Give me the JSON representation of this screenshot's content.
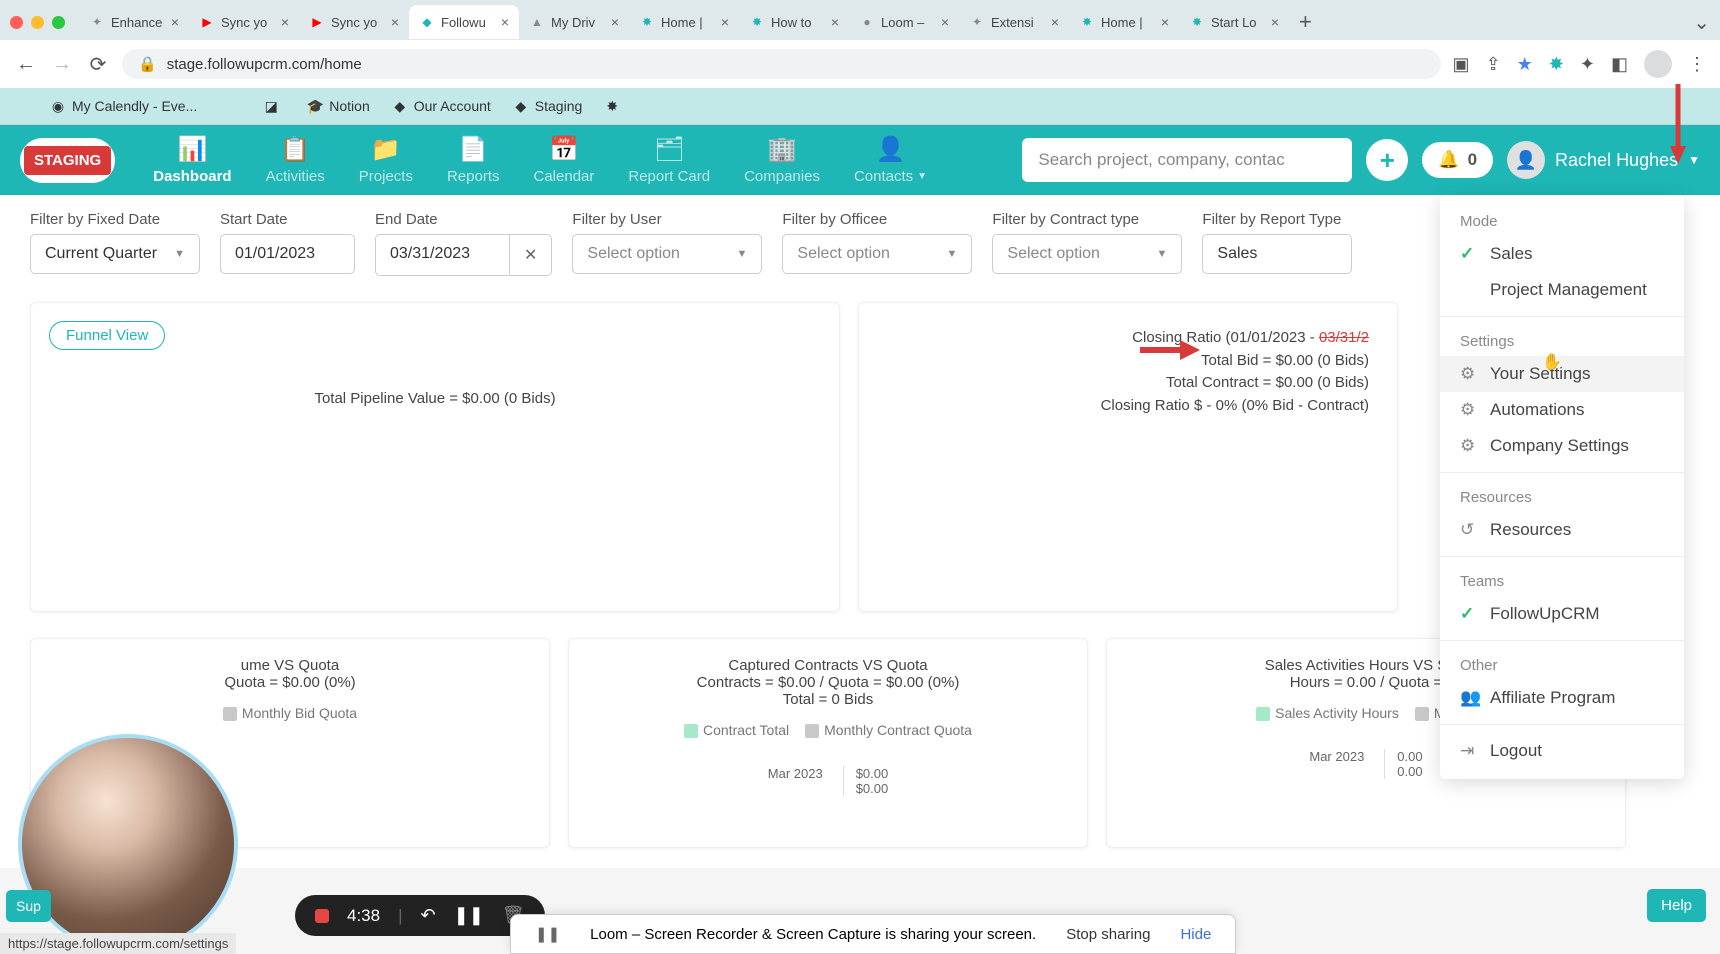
{
  "browser": {
    "tabs": [
      {
        "favicon": "✦",
        "title": "Enhance"
      },
      {
        "favicon": "▶",
        "title": "Sync yo",
        "fav_color": "#ff0000"
      },
      {
        "favicon": "▶",
        "title": "Sync yo",
        "fav_color": "#ff0000"
      },
      {
        "favicon": "◆",
        "title": "Followu",
        "active": true,
        "fav_color": "#1fb6b6"
      },
      {
        "favicon": "▲",
        "title": "My Driv"
      },
      {
        "favicon": "✸",
        "title": "Home |",
        "fav_color": "#1fb6b6"
      },
      {
        "favicon": "✸",
        "title": "How to",
        "fav_color": "#1fb6b6"
      },
      {
        "favicon": "●",
        "title": "Loom –"
      },
      {
        "favicon": "✦",
        "title": "Extensi"
      },
      {
        "favicon": "✸",
        "title": "Home |",
        "fav_color": "#1fb6b6"
      },
      {
        "favicon": "✸",
        "title": "Start Lo",
        "fav_color": "#1fb6b6"
      }
    ],
    "url": "stage.followupcrm.com/home",
    "bookmarks": [
      {
        "icon": "◉",
        "label": "My Calendly - Eve..."
      },
      {
        "icon": "",
        "label": ""
      },
      {
        "icon": "◪",
        "label": ""
      },
      {
        "icon": "🎓",
        "label": "Notion"
      },
      {
        "icon": "◆",
        "label": "Our Account"
      },
      {
        "icon": "◆",
        "label": "Staging"
      },
      {
        "icon": "✸",
        "label": ""
      }
    ]
  },
  "header": {
    "staging_label": "STAGING",
    "nav": [
      {
        "icon": "📊",
        "label": "Dashboard",
        "active": true
      },
      {
        "icon": "📋",
        "label": "Activities"
      },
      {
        "icon": "📁",
        "label": "Projects"
      },
      {
        "icon": "📄",
        "label": "Reports"
      },
      {
        "icon": "📅",
        "label": "Calendar"
      },
      {
        "icon": "🗂",
        "label": "Report Card"
      },
      {
        "icon": "🏢",
        "label": "Companies"
      },
      {
        "icon": "👤",
        "label": "Contacts",
        "caret": true
      }
    ],
    "search_placeholder": "Search project, company, contac",
    "notification_count": "0",
    "user_name": "Rachel Hughes"
  },
  "filters": {
    "fixed_date": {
      "label": "Filter by Fixed Date",
      "value": "Current Quarter"
    },
    "start_date": {
      "label": "Start Date",
      "value": "01/01/2023"
    },
    "end_date": {
      "label": "End Date",
      "value": "03/31/2023"
    },
    "by_user": {
      "label": "Filter by User",
      "value": "Select option"
    },
    "by_office": {
      "label": "Filter by Officee",
      "value": "Select option"
    },
    "by_contract": {
      "label": "Filter by Contract type",
      "value": "Select option"
    },
    "by_report": {
      "label": "Filter by Report Type",
      "value": "Sales"
    }
  },
  "pipeline": {
    "funnel_label": "Funnel View",
    "text": "Total Pipeline Value = $0.00 (0 Bids)"
  },
  "closing": {
    "line1": "Closing Ratio (01/01/2023 - ",
    "line2": "Total Bid = $0.00 (0 Bids)",
    "line3": "Total Contract = $0.00 (0 Bids)",
    "line4": "Closing Ratio $ - 0% (0% Bid - Contract)"
  },
  "chart1": {
    "title": "ume VS Quota",
    "sub": "Quota = $0.00 (0%)",
    "legend": "Monthly Bid Quota"
  },
  "chart2": {
    "title": "Captured Contracts VS Quota",
    "sub": "Contracts = $0.00 / Quota = $0.00 (0%)",
    "sub2": "Total = 0 Bids",
    "legend1": "Contract Total",
    "legend2": "Monthly Contract Quota",
    "x": "Mar 2023",
    "v1": "$0.00",
    "v2": "$0.00"
  },
  "chart3": {
    "title": "Sales Activities Hours VS Sale",
    "sub": "Hours = 0.00 / Quota = ",
    "legend1": "Sales Activity Hours",
    "legend2": "Monthl",
    "x": "Mar 2023",
    "v1": "0.00",
    "v2": "0.00"
  },
  "dropdown": {
    "mode_label": "Mode",
    "mode_items": [
      "Sales",
      "Project Management"
    ],
    "settings_label": "Settings",
    "settings_items": [
      "Your Settings",
      "Automations",
      "Company Settings"
    ],
    "resources_label": "Resources",
    "resources_item": "Resources",
    "teams_label": "Teams",
    "teams_item": "FollowUpCRM",
    "other_label": "Other",
    "affiliate": "Affiliate Program",
    "logout": "Logout"
  },
  "loom": {
    "time": "4:38",
    "banner": "Loom – Screen Recorder & Screen Capture is sharing your screen.",
    "stop": "Stop sharing",
    "hide": "Hide"
  },
  "help_label": "Help",
  "sup_label": "Sup",
  "status_url": "https://stage.followupcrm.com/settings"
}
